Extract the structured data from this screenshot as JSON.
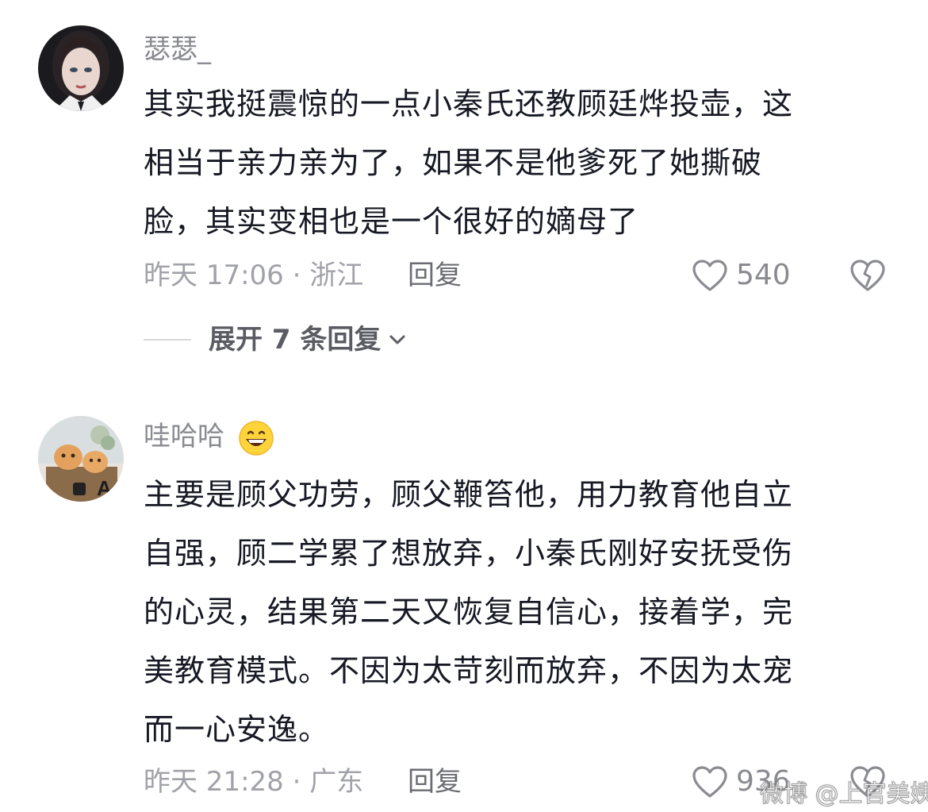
{
  "comments": [
    {
      "username": "瑟瑟_",
      "text_lines": [
        "其实我挺震惊的一点小秦氏还教顾廷烨投壶，这",
        "相当于亲力亲为了，如果不是他爹死了她撕破",
        "脸，其实变相也是一个很好的嫡母了"
      ],
      "meta": "昨天 17:06 · 浙江",
      "reply_label": "回复",
      "likes": "540",
      "expand_label": "展开 7 条回复"
    },
    {
      "username": "哇哈哈",
      "username_emoji": "grinning-face",
      "text_lines": [
        "主要是顾父功劳，顾父鞭笞他，用力教育他自立",
        "自强，顾二学累了想放弃，小秦氏刚好安抚受伤",
        "的心灵，结果第二天又恢复自信心，接着学，完",
        "美教育模式。不因为太苛刻而放弃，不因为太宠",
        "而一心安逸。"
      ],
      "meta": "昨天 21:28 · 广东",
      "reply_label": "回复",
      "likes": "936"
    }
  ],
  "watermark": "微博 @上官美姨",
  "icons": {
    "like": "heart-outline-icon",
    "dislike": "broken-heart-icon",
    "expand": "chevron-down-icon"
  },
  "colors": {
    "text": "#161823",
    "username": "#8a8b91",
    "meta": "#a1a2a8"
  }
}
